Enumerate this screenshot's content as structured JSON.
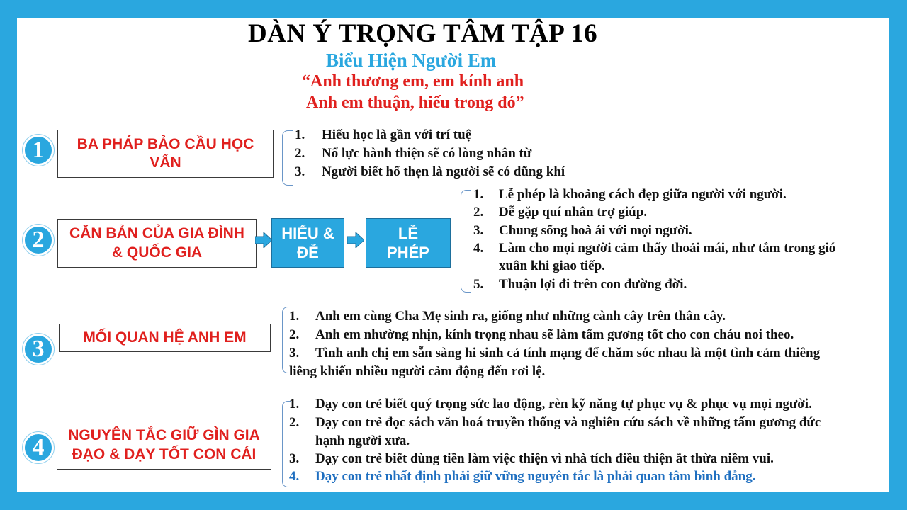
{
  "title": "DÀN Ý TRỌNG TÂM TẬP 16",
  "subtitle": "Biểu Hiện Người Em",
  "quote": [
    "“Anh thương em, em kính anh",
    "Anh em thuận, hiếu trong đó”"
  ],
  "sections": [
    {
      "number": "1",
      "box": [
        "BA PHÁP BẢO CẦU HỌC",
        "VẤN"
      ],
      "items": [
        "Hiếu học là gần với trí tuệ",
        "Nổ lực hành thiện sẽ có lòng nhân từ",
        "Người biết hổ thẹn là người sẽ có dũng khí"
      ]
    },
    {
      "number": "2",
      "box": [
        "CĂN BẢN CỦA GIA ĐÌNH",
        "& QUỐC GIA"
      ],
      "mid_box": [
        "HIẾU &",
        "ĐỄ"
      ],
      "end_box": [
        "LỄ",
        "PHÉP"
      ],
      "items": [
        "Lễ phép là khoảng cách đẹp giữa người với người.",
        "Dễ gặp quí nhân trợ giúp.",
        "Chung sống hoà ái với mọi người.",
        "Làm cho mọi người cảm thấy thoải mái, như tắm trong gió",
        "xuân khi giao tiếp.",
        "Thuận lợi đi trên con đường đời."
      ]
    },
    {
      "number": "3",
      "box": [
        "MỐI QUAN HỆ ANH EM"
      ],
      "items": [
        "Anh em cùng Cha Mẹ sinh ra, giống như những cành cây trên thân cây.",
        "Anh em nhường nhịn, kính trọng nhau sẽ làm tấm gương tốt cho con cháu noi theo.",
        "Tình anh chị em sẵn sàng hi sinh cả tính mạng để chăm sóc nhau là một tình cảm thiêng",
        "liêng khiến nhiều người cảm động đến rơi lệ."
      ]
    },
    {
      "number": "4",
      "box": [
        "NGUYÊN TẮC GIỮ GÌN GIA",
        "ĐẠO & DẠY TỐT CON CÁI"
      ],
      "items": [
        "Dạy con trẻ biết quý trọng sức lao động, rèn kỹ năng tự phục vụ & phục vụ mọi người.",
        "Dạy con trẻ đọc sách văn hoá truyền thống và nghiên cứu sách về những tấm gương đức",
        "hạnh người xưa.",
        "Dạy con trẻ biết dùng tiền làm việc thiện vì nhà tích điều thiện ắt thừa niềm vui.",
        "Dạy con trẻ nhất định phải giữ vững nguyên tắc là phải quan tâm bình đẳng."
      ]
    }
  ],
  "numbering": {
    "s1": [
      "1.",
      "2.",
      "3."
    ],
    "s2": [
      "1.",
      "2.",
      "3.",
      "4.",
      "5."
    ],
    "s3": [
      "1.",
      "2.",
      "3."
    ],
    "s4": [
      "1.",
      "2.",
      "3.",
      "4."
    ]
  },
  "colors": {
    "frame": "#2aa7df",
    "accent_red": "#e0201e",
    "accent_blue": "#1f6fc0"
  }
}
